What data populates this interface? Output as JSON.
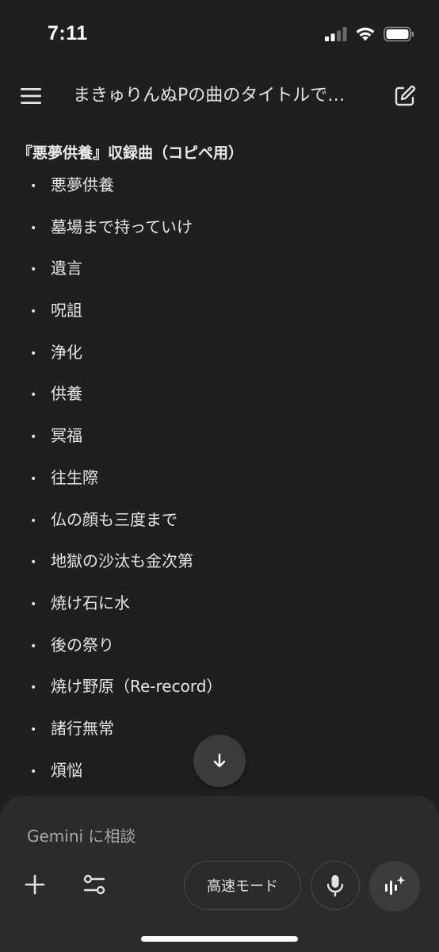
{
  "status_bar": {
    "time": "7:11"
  },
  "header": {
    "title": "まきゅりんぬPの曲のタイトルで…",
    "menu_icon": "hamburger-menu-icon",
    "new_chat_icon": "edit-square-icon"
  },
  "content": {
    "heading": "『悪夢供養』収録曲（コピペ用）",
    "songs": [
      "悪夢供養",
      "墓場まで持っていけ",
      "遺言",
      "呪詛",
      "浄化",
      "供養",
      "冥福",
      "往生際",
      "仏の顔も三度まで",
      "地獄の沙汰も金次第",
      "焼け石に水",
      "後の祭り",
      "焼け野原（Re-record）",
      "諸行無常",
      "煩悩"
    ],
    "bullet": "•"
  },
  "composer": {
    "placeholder": "Gemini に相談",
    "mode_label": "高速モード",
    "add_icon": "plus-icon",
    "tools_icon": "sliders-icon",
    "mic_icon": "microphone-icon",
    "live_icon": "live-waveform-sparkle-icon"
  },
  "colors": {
    "background": "#1f1f20",
    "panel": "#2b2b2d",
    "text": "#e6e6e6",
    "placeholder": "#a8a8a8"
  }
}
